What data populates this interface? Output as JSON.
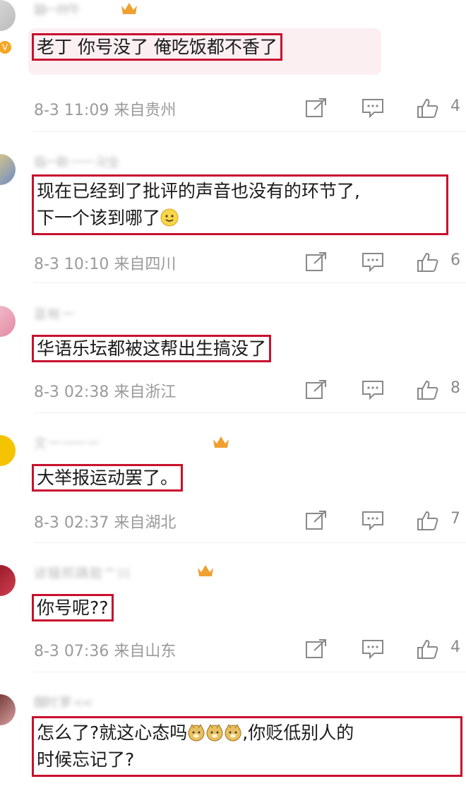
{
  "comments": [
    {
      "text": "老丁 你号没了 俺吃饭都不香了",
      "time": "8-3 11:09",
      "location": "来自贵州",
      "likes": "4",
      "username": "鼬一卅牛"
    },
    {
      "text_line1": "现在已经到了批评的声音也没有的环节了,",
      "text_line2": "下一个该到哪了",
      "time": "8-3 10:10",
      "location": "来自四川",
      "likes": "6",
      "username": "临一新 一一 卍全"
    },
    {
      "text": "华语乐坛都被这帮出生搞没了",
      "time": "8-3 02:38",
      "location": "来自浙江",
      "likes": "8",
      "username": "蓝 帐 一"
    },
    {
      "text": "大举报运动罢了。",
      "time": "8-3 02:37",
      "location": "来自湖北",
      "likes": "7",
      "username": "文 一 一一 一"
    },
    {
      "text": "你号呢??",
      "time": "8-3 07:36",
      "location": "来自山东",
      "likes": "4",
      "username": "谚 騷 熙 蹒 懿 亠 川"
    },
    {
      "text_line1": "怎么了?就这心态吗",
      "text_line1_end": ",你贬低别人的",
      "text_line2": "时候忘记了?",
      "username": "醒时 萝 <<"
    }
  ],
  "icons": {
    "share": "share-icon",
    "comment": "comment-icon",
    "like": "thumbs-up-icon",
    "smile": "smile-emoji",
    "doge": "doge-emoji",
    "crown": "crown-icon",
    "verified": "verified-badge"
  },
  "colors": {
    "highlight": "#c8102e",
    "meta": "#9a9a9a"
  }
}
